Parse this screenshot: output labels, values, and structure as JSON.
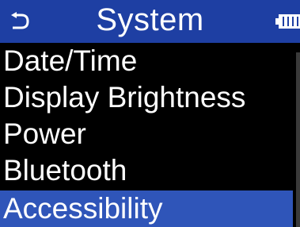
{
  "header": {
    "title": "System",
    "back_icon": "back-arrow-icon",
    "battery_icon": "battery-icon"
  },
  "menu": {
    "items": [
      {
        "label": "Date/Time"
      },
      {
        "label": "Display Brightness"
      },
      {
        "label": "Power"
      },
      {
        "label": "Bluetooth"
      },
      {
        "label": "Accessibility",
        "selected": true
      }
    ]
  },
  "colors": {
    "header_background": "#1e3fa3",
    "selected_background": "#2f55b9",
    "background": "#000000",
    "text": "#ffffff"
  }
}
